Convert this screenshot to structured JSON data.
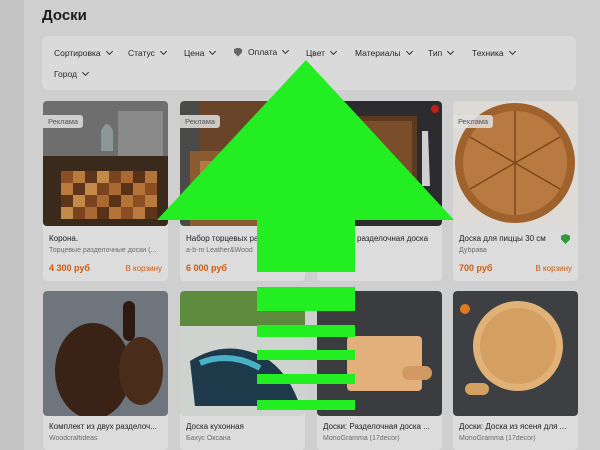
{
  "page": {
    "title": "Доски"
  },
  "filters": {
    "sort": "Сортировка",
    "status": "Статус",
    "price": "Цена",
    "payment": "Оплата",
    "color": "Цвет",
    "materials": "Материалы",
    "type": "Тип",
    "technique": "Техника",
    "city": "Город"
  },
  "products": [
    {
      "ad_label": "Реклама",
      "title": "Корона.",
      "seller": "Торцевые разделочные доски (...",
      "price": "4 300 руб",
      "cart": "В корзину"
    },
    {
      "ad_label": "Реклама",
      "title": "Набор торцевых ра",
      "seller": "a-b-m Leather&Wood",
      "price": "6 000 руб",
      "cart": ""
    },
    {
      "ad_label": "",
      "title": "разделочная доска",
      "seller": "",
      "price": "",
      "cart": ""
    },
    {
      "ad_label": "Реклама",
      "title": "Доска для пиццы 30 см",
      "seller": "Дубрава",
      "price": "700 руб",
      "cart": "В корзину",
      "verified": true
    },
    {
      "title": "Комплект из двух разделоч...",
      "seller": "Woodcraftideas"
    },
    {
      "title": "Доска кухонная",
      "seller": "Бахус Оксана"
    },
    {
      "title": "Доски: Разделочная доска ...",
      "seller": "MonoGramma (17decor)"
    },
    {
      "title": "Доски: Доска из ясеня для ...",
      "seller": "MonoGramma (17decor)"
    }
  ],
  "colors": {
    "accent": "#cc5a14",
    "overlay_arrow": "#22ee22",
    "verified": "#2e9a3e"
  }
}
